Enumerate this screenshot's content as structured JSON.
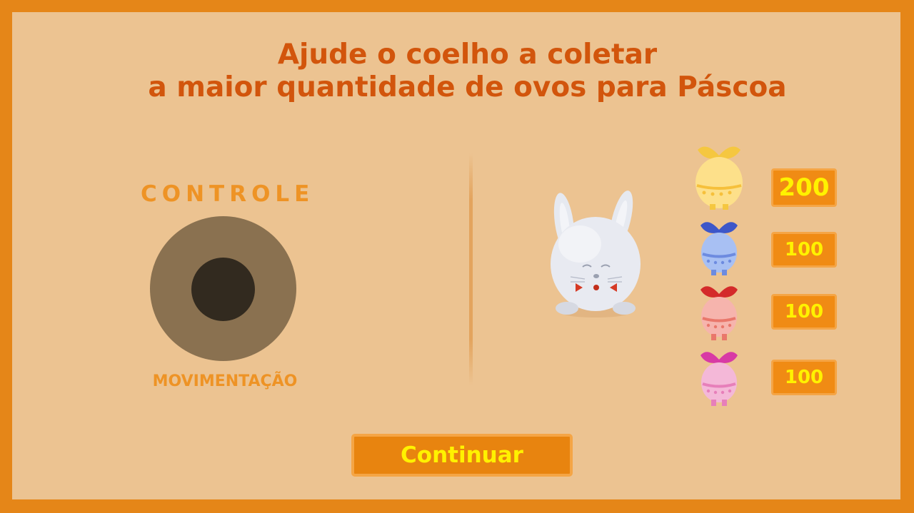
{
  "title": {
    "line1": "Ajude o coelho a coletar",
    "line2": "a maior quantidade de ovos para Páscoa"
  },
  "controls": {
    "heading": "CONTROLE",
    "joystick_caption": "MOVIMENTAÇÃO"
  },
  "eggs": [
    {
      "color": "yellow",
      "points": "200"
    },
    {
      "color": "blue",
      "points": "100"
    },
    {
      "color": "red",
      "points": "100"
    },
    {
      "color": "pink",
      "points": "100"
    }
  ],
  "continue_label": "Continuar",
  "colors": {
    "frame": "#e58618",
    "panel": "#ecc391",
    "title": "#d2550c",
    "accent": "#ee9325",
    "score_text": "#fff200"
  }
}
